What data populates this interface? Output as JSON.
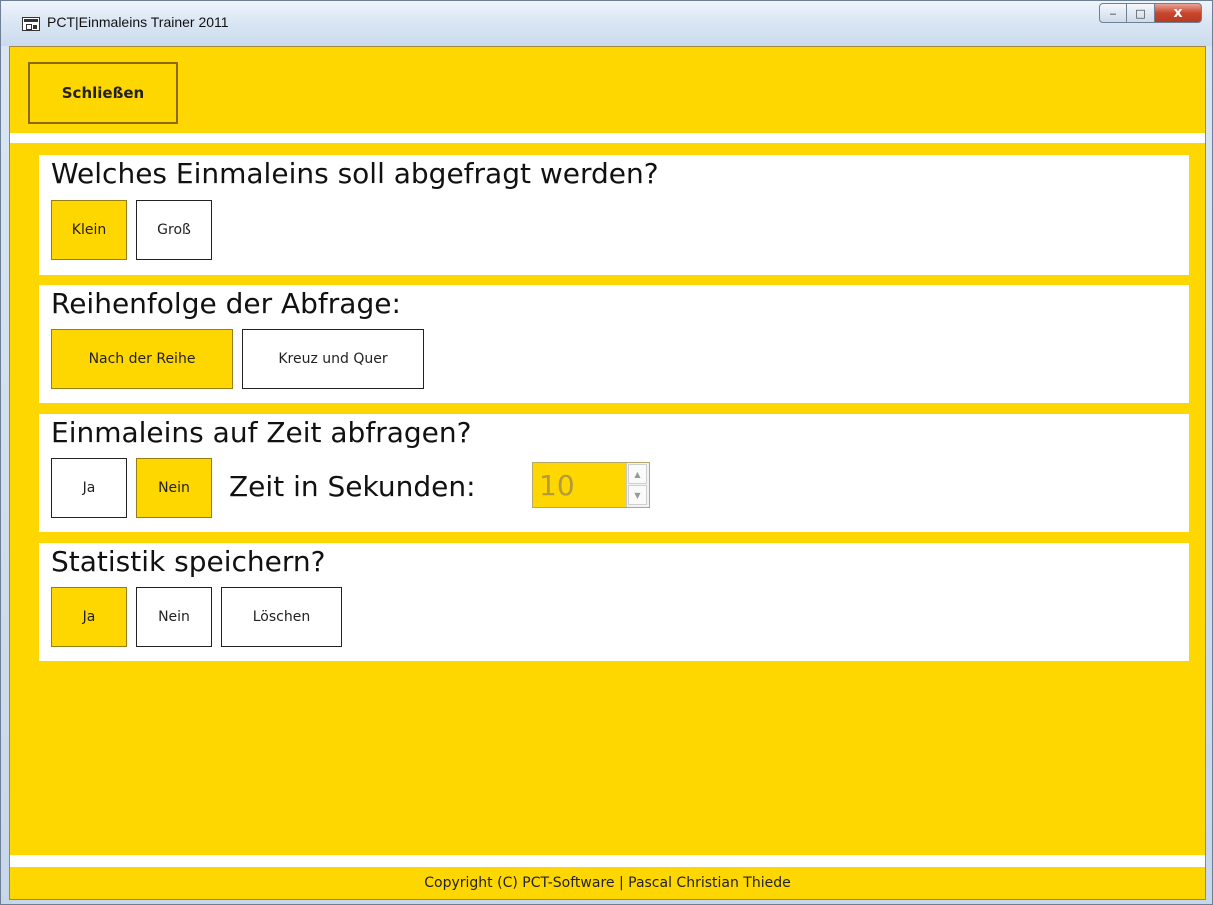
{
  "window": {
    "title": "PCT|Einmaleins Trainer 2011",
    "caption": {
      "minimize": "‒",
      "maximize": "□",
      "close": "x"
    }
  },
  "toolbar": {
    "close_label": "Schließen"
  },
  "sections": {
    "einmaleins": {
      "title": "Welches Einmaleins soll abgefragt werden?",
      "options": [
        "Klein",
        "Groß"
      ],
      "selected": "Klein"
    },
    "reihenfolge": {
      "title": "Reihenfolge der Abfrage:",
      "options": [
        "Nach der Reihe",
        "Kreuz und Quer"
      ],
      "selected": "Nach der Reihe"
    },
    "zeit": {
      "title": "Einmaleins auf Zeit abfragen?",
      "options": [
        "Ja",
        "Nein"
      ],
      "selected": "Nein",
      "seconds_label": "Zeit in Sekunden:",
      "seconds_value": "10"
    },
    "statistik": {
      "title": "Statistik speichern?",
      "options": [
        "Ja",
        "Nein",
        "Löschen"
      ],
      "selected": "Ja"
    }
  },
  "footer": {
    "copyright": "Copyright (C) PCT-Software | Pascal Christian Thiede"
  },
  "colors": {
    "accent": "#ffd700",
    "panel": "#ffffff",
    "frame": "#c7d7ea",
    "close_button": "#c9462c"
  }
}
